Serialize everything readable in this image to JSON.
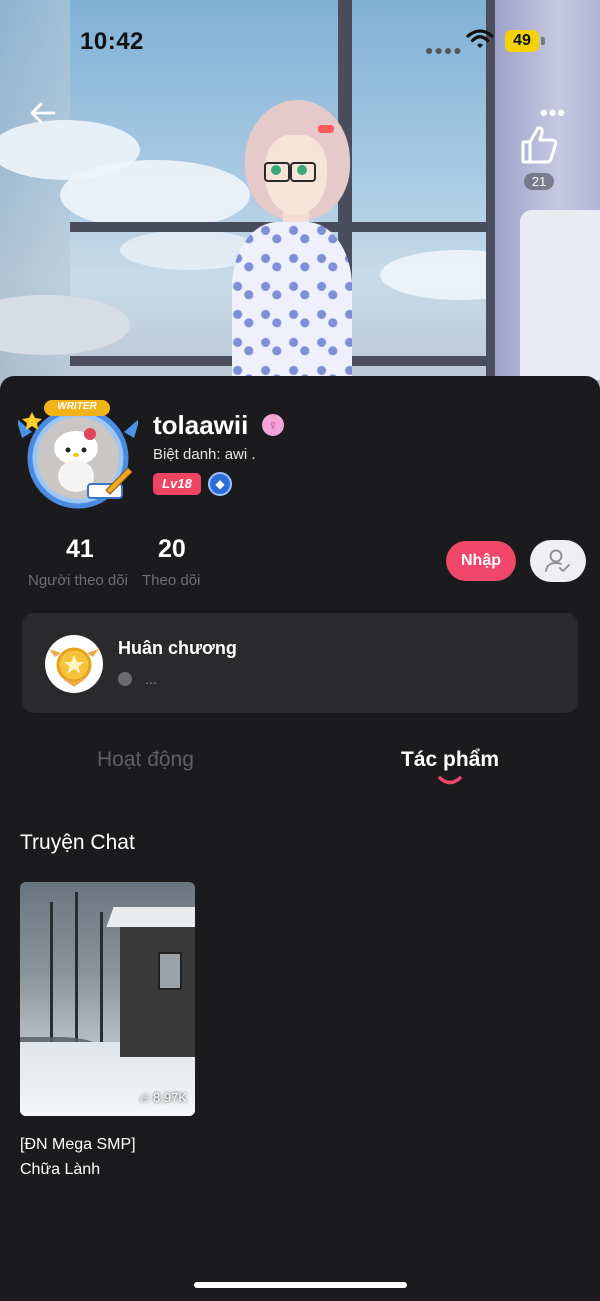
{
  "status_bar": {
    "time": "10:42",
    "battery": "49"
  },
  "header": {
    "likes": "21"
  },
  "profile": {
    "avatar_badge": "WRITER",
    "username": "tolaawii",
    "nickname": "Biệt danh: awi .",
    "level": "Lv18"
  },
  "stats": [
    {
      "value": "41",
      "label": "Người theo dõi"
    },
    {
      "value": "20",
      "label": "Theo dõi"
    }
  ],
  "actions": {
    "nhap_label": "Nhập"
  },
  "medals": {
    "title": "Huân chương",
    "subtitle": "..."
  },
  "tabs": [
    {
      "label": "Hoạt động",
      "active": false
    },
    {
      "label": "Tác phẩm",
      "active": true
    }
  ],
  "section": {
    "title": "Truyện Chat"
  },
  "stories": [
    {
      "views": "8.97K",
      "title_line1": "[ĐN Mega SMP]",
      "title_line2": "Chữa Lành"
    }
  ],
  "colors": {
    "accent": "#f0476a",
    "background": "#1b1b1d",
    "card": "#2a2a2d"
  }
}
